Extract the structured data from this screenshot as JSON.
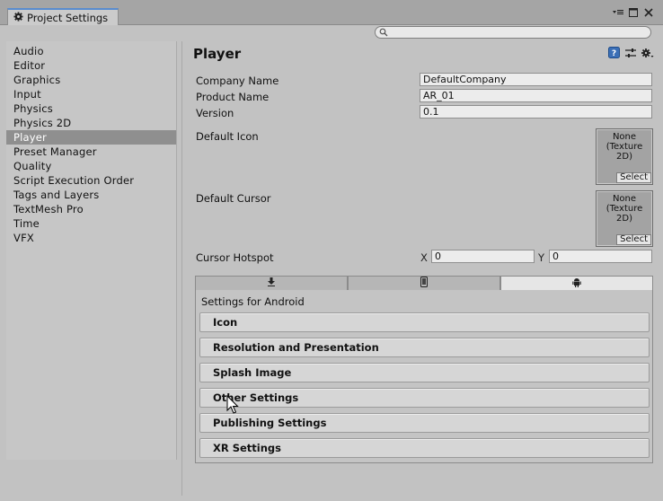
{
  "window": {
    "tab_title": "Project Settings",
    "controls": [
      "menu-icon",
      "maximize-icon",
      "close-icon"
    ]
  },
  "search": {
    "value": "",
    "placeholder": ""
  },
  "sidebar": {
    "items": [
      {
        "label": "Audio"
      },
      {
        "label": "Editor"
      },
      {
        "label": "Graphics"
      },
      {
        "label": "Input"
      },
      {
        "label": "Physics"
      },
      {
        "label": "Physics 2D"
      },
      {
        "label": "Player",
        "selected": true
      },
      {
        "label": "Preset Manager"
      },
      {
        "label": "Quality"
      },
      {
        "label": "Script Execution Order"
      },
      {
        "label": "Tags and Layers"
      },
      {
        "label": "TextMesh Pro"
      },
      {
        "label": "Time"
      },
      {
        "label": "VFX"
      }
    ]
  },
  "main": {
    "title": "Player",
    "header_icons": [
      "help-icon",
      "preset-icon",
      "settings-icon"
    ],
    "company_name": {
      "label": "Company Name",
      "value": "DefaultCompany"
    },
    "product_name": {
      "label": "Product Name",
      "value": "AR_01"
    },
    "version": {
      "label": "Version",
      "value": "0.1"
    },
    "default_icon": {
      "label": "Default Icon",
      "preview_text": "None\n(Texture\n2D)",
      "select_label": "Select"
    },
    "default_cursor": {
      "label": "Default Cursor",
      "preview_text": "None\n(Texture\n2D)",
      "select_label": "Select"
    },
    "cursor_hotspot": {
      "label": "Cursor Hotspot",
      "x_label": "X",
      "x_value": "0",
      "y_label": "Y",
      "y_value": "0"
    },
    "platform_tabs": [
      {
        "icon": "download-icon",
        "platform": "standalone"
      },
      {
        "icon": "phone-icon",
        "platform": "mobile"
      },
      {
        "icon": "android-icon",
        "platform": "android",
        "active": true
      }
    ],
    "settings_for": "Settings for Android",
    "sections": [
      {
        "label": "Icon"
      },
      {
        "label": "Resolution and Presentation"
      },
      {
        "label": "Splash Image"
      },
      {
        "label": "Other Settings"
      },
      {
        "label": "Publishing Settings"
      },
      {
        "label": "XR Settings"
      }
    ]
  }
}
